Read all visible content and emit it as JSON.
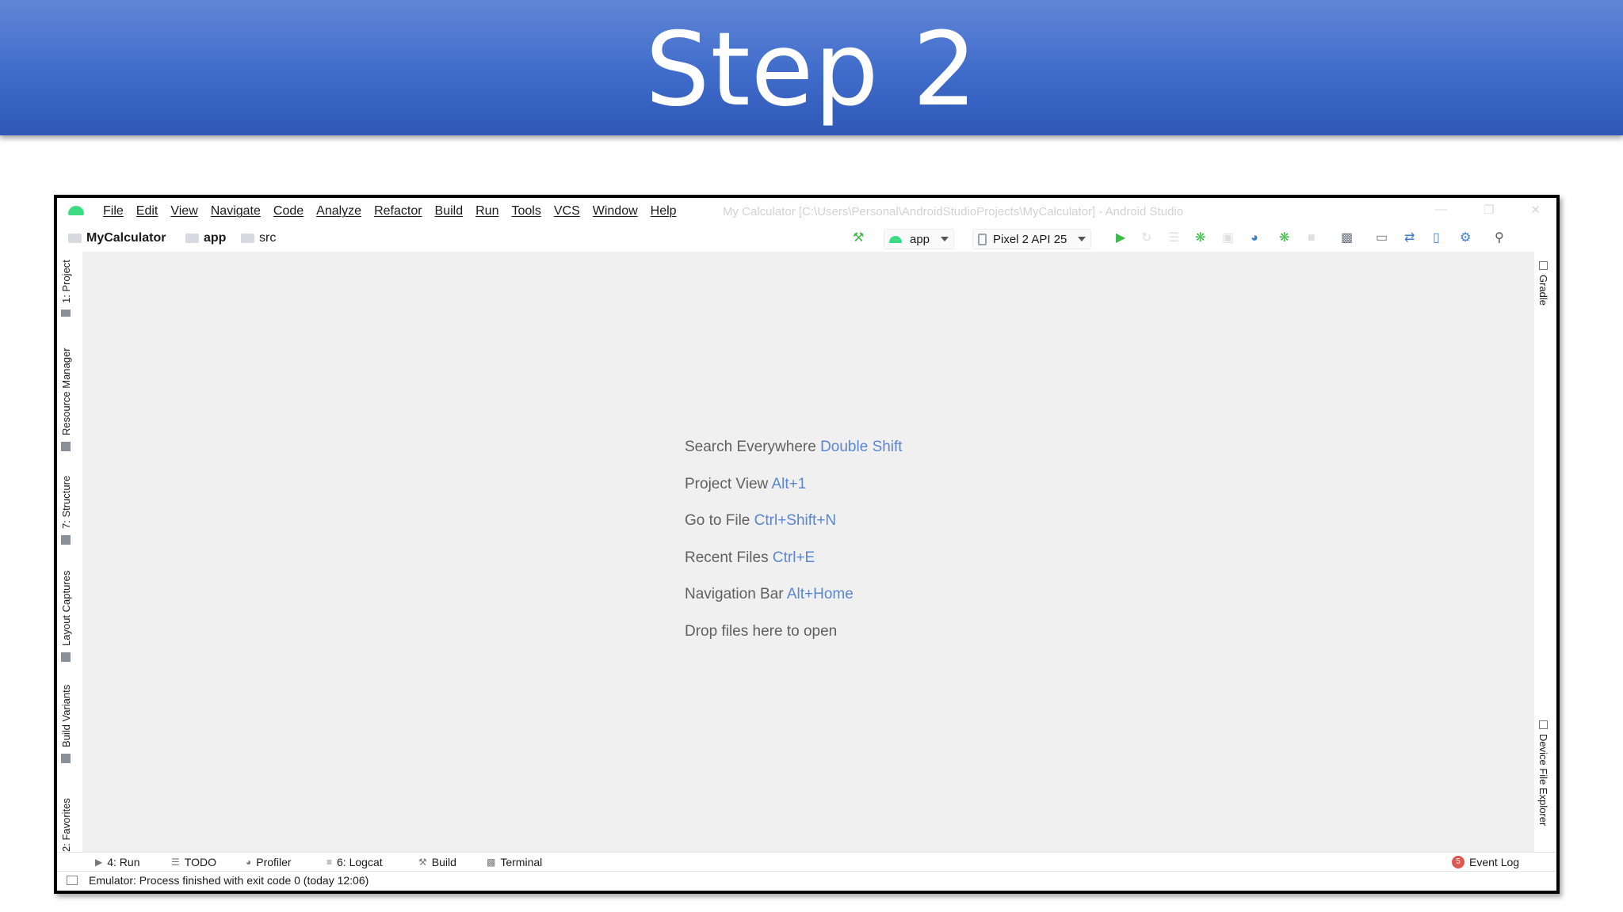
{
  "slide": {
    "title": "Step 2"
  },
  "window": {
    "title": "My Calculator [C:\\Users\\Personal\\AndroidStudioProjects\\MyCalculator] - Android Studio",
    "menu": [
      "File",
      "Edit",
      "View",
      "Navigate",
      "Code",
      "Analyze",
      "Refactor",
      "Build",
      "Run",
      "Tools",
      "VCS",
      "Window",
      "Help"
    ]
  },
  "breadcrumb": {
    "project": "MyCalculator",
    "module": "app",
    "folder": "src"
  },
  "toolbar": {
    "config": "app",
    "device": "Pixel 2 API 25"
  },
  "left_tabs": [
    "1: Project",
    "Resource Manager",
    "7: Structure",
    "Layout Captures",
    "Build Variants",
    "2: Favorites"
  ],
  "right_tabs": [
    "Gradle",
    "Device File Explorer"
  ],
  "editor_hints": [
    {
      "label": "Search Everywhere",
      "key": "Double Shift"
    },
    {
      "label": "Project View",
      "key": "Alt+1"
    },
    {
      "label": "Go to File",
      "key": "Ctrl+Shift+N"
    },
    {
      "label": "Recent Files",
      "key": "Ctrl+E"
    },
    {
      "label": "Navigation Bar",
      "key": "Alt+Home"
    },
    {
      "label": "Drop files here to open",
      "key": ""
    }
  ],
  "bottom_tabs": [
    "4: Run",
    "TODO",
    "Profiler",
    "6: Logcat",
    "Build",
    "Terminal"
  ],
  "event_log": {
    "label": "Event Log",
    "count": "5"
  },
  "status": "Emulator: Process finished with exit code 0 (today 12:06)",
  "colors": {
    "banner": "#3f6bca",
    "hint_key": "#5a86d0",
    "android_green": "#3ddc84",
    "run_green": "#3cb94a"
  }
}
